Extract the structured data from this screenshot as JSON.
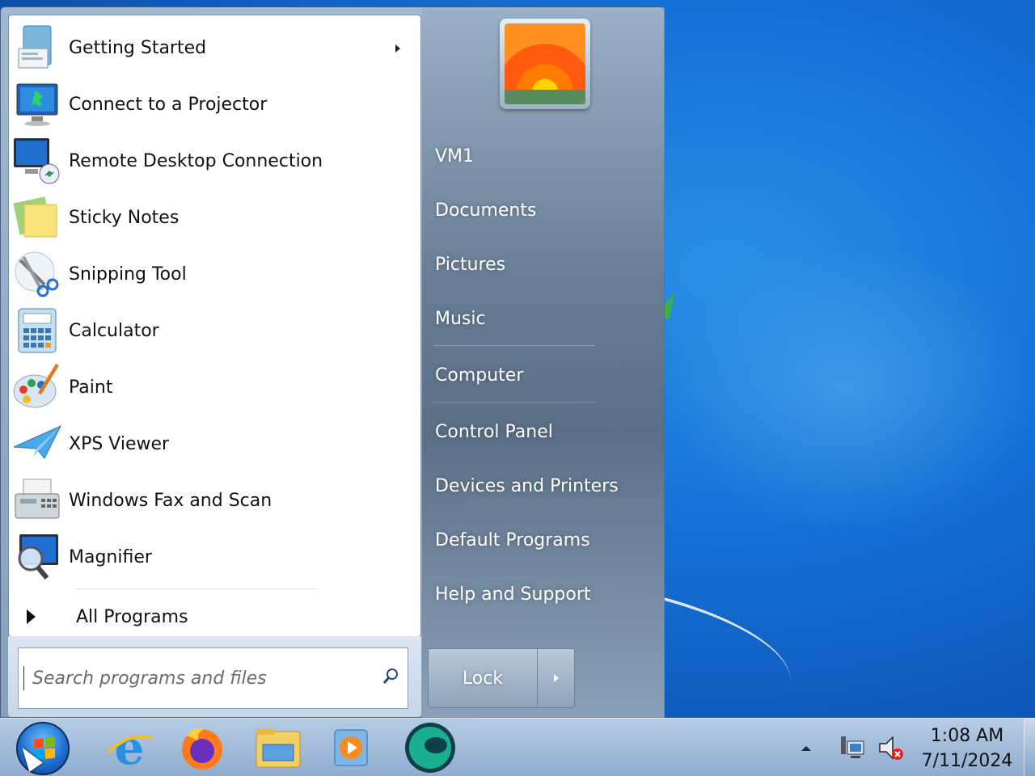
{
  "start_menu": {
    "programs": [
      {
        "label": "Getting Started",
        "icon": "getting-started-icon",
        "has_submenu": true
      },
      {
        "label": "Connect to a Projector",
        "icon": "projector-icon"
      },
      {
        "label": "Remote Desktop Connection",
        "icon": "remote-desktop-icon"
      },
      {
        "label": "Sticky Notes",
        "icon": "sticky-notes-icon"
      },
      {
        "label": "Snipping Tool",
        "icon": "snipping-tool-icon"
      },
      {
        "label": "Calculator",
        "icon": "calculator-icon"
      },
      {
        "label": "Paint",
        "icon": "paint-icon"
      },
      {
        "label": "XPS Viewer",
        "icon": "xps-viewer-icon"
      },
      {
        "label": "Windows Fax and Scan",
        "icon": "fax-scan-icon"
      },
      {
        "label": "Magnifier",
        "icon": "magnifier-icon"
      }
    ],
    "all_programs_label": "All Programs",
    "search": {
      "placeholder": "Search programs and files",
      "value": ""
    },
    "right_items": [
      {
        "label": "VM1"
      },
      {
        "label": "Documents"
      },
      {
        "label": "Pictures"
      },
      {
        "label": "Music"
      },
      {
        "label": "Computer"
      },
      {
        "label": "Control Panel"
      },
      {
        "label": "Devices and Printers"
      },
      {
        "label": "Default Programs"
      },
      {
        "label": "Help and Support"
      }
    ],
    "lock_label": "Lock",
    "user_picture_icon": "flower-user-picture"
  },
  "taskbar": {
    "pinned": [
      {
        "name": "internet-explorer-icon"
      },
      {
        "name": "firefox-icon"
      },
      {
        "name": "file-explorer-icon"
      },
      {
        "name": "media-player-icon"
      },
      {
        "name": "app-globe-icon"
      }
    ],
    "clock": {
      "time": "1:08 AM",
      "date": "7/11/2024"
    },
    "tray": [
      "network-icon",
      "volume-muted-icon"
    ]
  },
  "colors": {
    "accent": "#1672d6",
    "menu_right": "#5f738a",
    "text_dark": "#111111"
  }
}
